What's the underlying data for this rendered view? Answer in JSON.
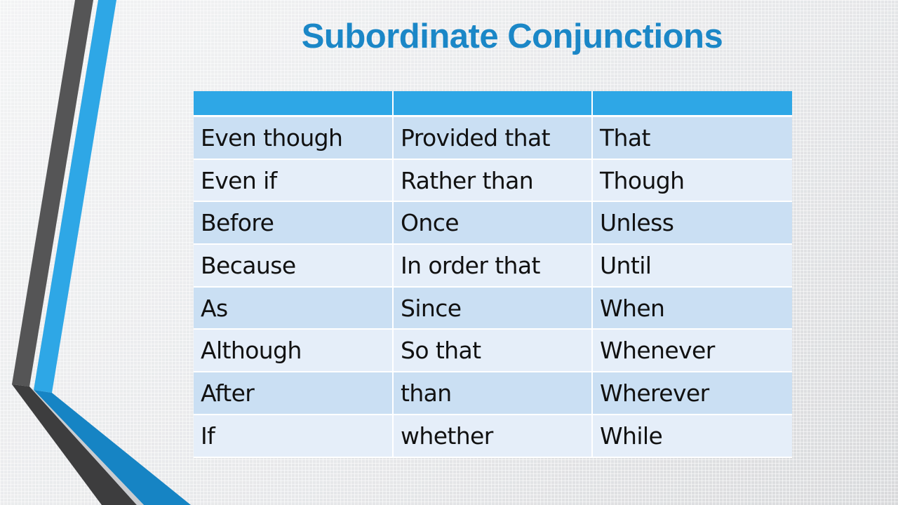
{
  "slide": {
    "title": "Subordinate Conjunctions",
    "colors": {
      "title": "#1b87c7",
      "header": "#2ea7e6",
      "stripe_dark": "#555556",
      "stripe_blue": "#2ea7e6",
      "stripe_blue_lower": "#1684c4",
      "stripe_dark_lower": "#3d3d3e"
    }
  },
  "table": {
    "header": [
      "",
      "",
      ""
    ],
    "rows": [
      [
        "Even though",
        "Provided that",
        "That"
      ],
      [
        "Even if",
        "Rather than",
        "Though"
      ],
      [
        "Before",
        "Once",
        "Unless"
      ],
      [
        "Because",
        "In order that",
        "Until"
      ],
      [
        "As",
        "Since",
        "When"
      ],
      [
        "Although",
        "So that",
        "Whenever"
      ],
      [
        "After",
        "than",
        "Wherever"
      ],
      [
        "If",
        "whether",
        "While"
      ]
    ]
  }
}
